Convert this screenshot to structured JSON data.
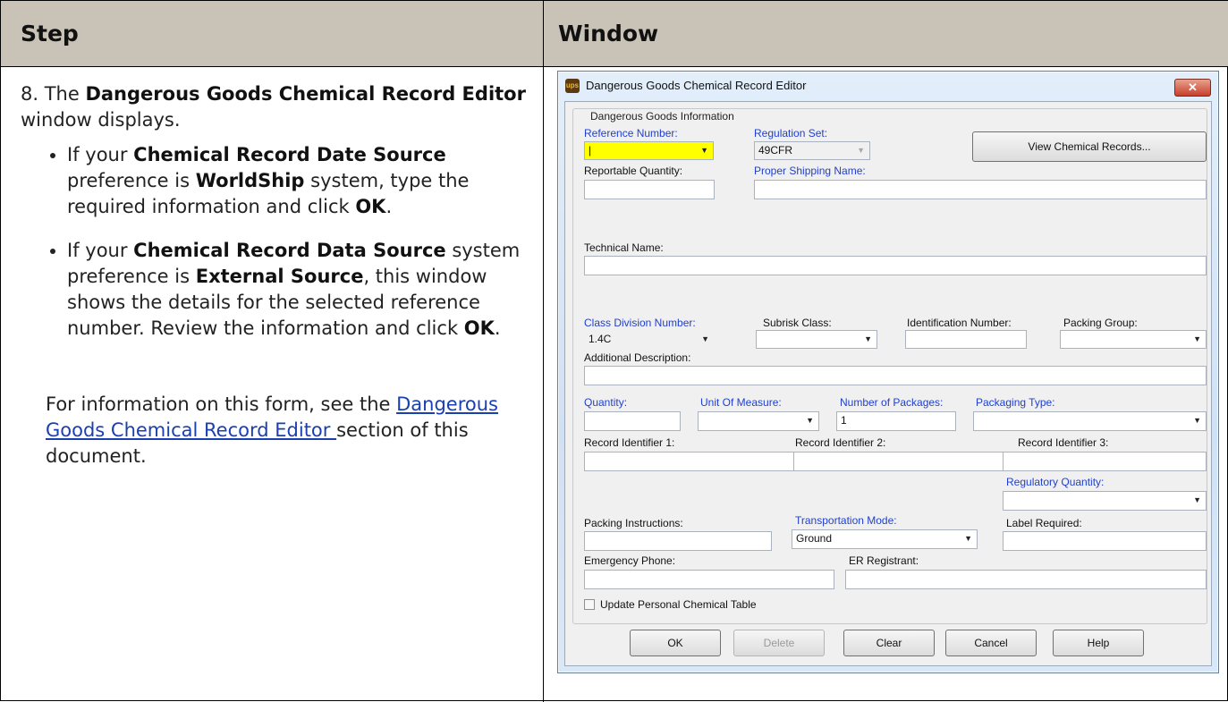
{
  "table": {
    "col_step": "Step",
    "col_window": "Window"
  },
  "step": {
    "intro_num": "8. The ",
    "intro_bold": "Dangerous Goods Chemical Record Editor",
    "intro_tail": " window displays.",
    "b1_a": "If your ",
    "b1_b": "Chemical Record Date Source",
    "b1_c": " preference is ",
    "b1_d": "WorldShip",
    "b1_e": " system, type the required information and click ",
    "b1_f": "OK",
    "b1_g": ".",
    "b2_a": "If your ",
    "b2_b": "Chemical Record Data Source",
    "b2_c": " system preference is ",
    "b2_d": "External Source",
    "b2_e": ", this window shows the details for the selected reference number. Review the information and click ",
    "b2_f": "OK",
    "b2_g": ".",
    "note_a": "For information on this form, see the ",
    "note_link": "Dangerous Goods Chemical Record Editor ",
    "note_b": "section of this document."
  },
  "dialog": {
    "title": "Dangerous Goods Chemical Record Editor",
    "app_icon": "ups-shield-icon",
    "close_label": "✕",
    "group_label": "Dangerous Goods Information",
    "reference_number_label": "Reference Number:",
    "reference_number_value": "|",
    "regulation_set_label": "Regulation Set:",
    "regulation_set_value": "49CFR",
    "view_records_label": "View Chemical Records...",
    "reportable_quantity_label": "Reportable Quantity:",
    "proper_shipping_name_label": "Proper Shipping Name:",
    "technical_name_label": "Technical Name:",
    "class_division_label": "Class Division Number:",
    "class_division_value": "1.4C",
    "subrisk_label": "Subrisk Class:",
    "identification_label": "Identification Number:",
    "packing_group_label": "Packing Group:",
    "additional_description_label": "Additional Description:",
    "quantity_label": "Quantity:",
    "unit_of_measure_label": "Unit Of Measure:",
    "number_of_packages_label": "Number of Packages:",
    "number_of_packages_value": "1",
    "packaging_type_label": "Packaging Type:",
    "record_id1_label": "Record Identifier 1:",
    "record_id2_label": "Record Identifier 2:",
    "record_id3_label": "Record Identifier 3:",
    "regulatory_quantity_label": "Regulatory Quantity:",
    "packing_instructions_label": "Packing Instructions:",
    "transportation_mode_label": "Transportation Mode:",
    "transportation_mode_value": "Ground",
    "label_required_label": "Label Required:",
    "emergency_phone_label": "Emergency Phone:",
    "er_registrant_label": "ER Registrant:",
    "update_table_label": "Update Personal Chemical Table",
    "buttons": {
      "ok": "OK",
      "delete": "Delete",
      "clear": "Clear",
      "cancel": "Cancel",
      "help": "Help"
    },
    "dropdown_glyph": "▼"
  }
}
